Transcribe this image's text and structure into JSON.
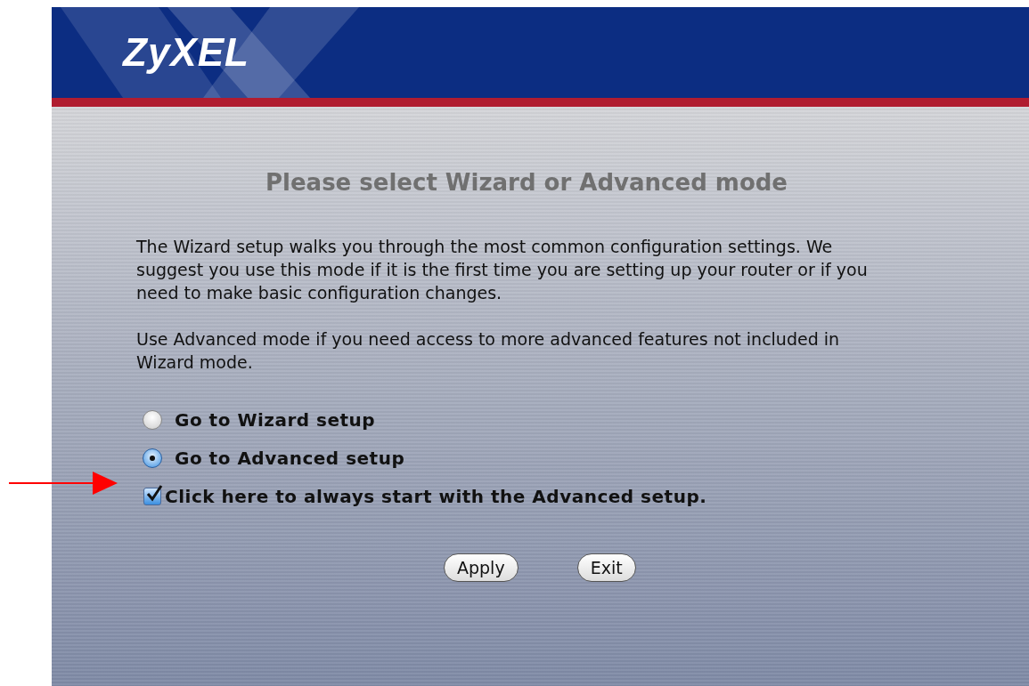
{
  "header": {
    "logo": "ZyXEL"
  },
  "title": "Please select Wizard or Advanced mode",
  "paragraphs": [
    "The Wizard setup walks you through the most common configuration settings. We suggest you use this mode if it is the first time you are setting up your router or if you need to make basic configuration changes.",
    "Use Advanced mode if you need access to more advanced features not included in Wizard mode."
  ],
  "options": [
    {
      "kind": "radio",
      "label": "Go to Wizard setup",
      "selected": false
    },
    {
      "kind": "radio",
      "label": "Go to Advanced setup",
      "selected": true
    },
    {
      "kind": "checkbox",
      "label": "Click here to always start with the Advanced setup.",
      "checked": true
    }
  ],
  "buttons": [
    "Apply",
    "Exit"
  ]
}
